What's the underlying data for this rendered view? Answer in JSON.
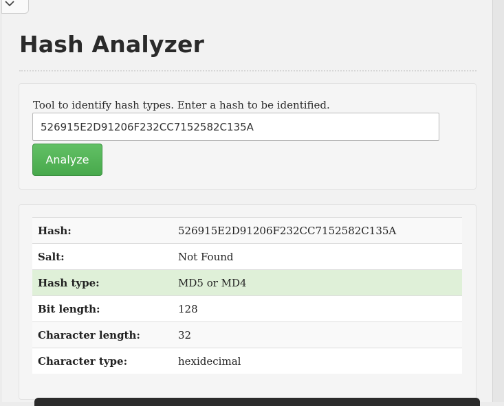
{
  "page": {
    "title": "Hash Analyzer"
  },
  "form": {
    "intro_text": "Tool to identify hash types. Enter a hash to be identified.",
    "hash_value": "526915E2D91206F232CC7152582C135A",
    "analyze_label": "Analyze"
  },
  "results": {
    "rows": [
      {
        "label": "Hash:",
        "value": "526915E2D91206F232CC7152582C135A"
      },
      {
        "label": "Salt:",
        "value": "Not Found"
      },
      {
        "label": "Hash type:",
        "value": "MD5 or MD4"
      },
      {
        "label": "Bit length:",
        "value": "128"
      },
      {
        "label": "Character length:",
        "value": "32"
      },
      {
        "label": "Character type:",
        "value": "hexidecimal"
      }
    ]
  },
  "icons": {
    "dropdown": "chevron-down-icon"
  },
  "colors": {
    "button_green": "#5cb85c",
    "highlight_row": "#dff0d8"
  }
}
